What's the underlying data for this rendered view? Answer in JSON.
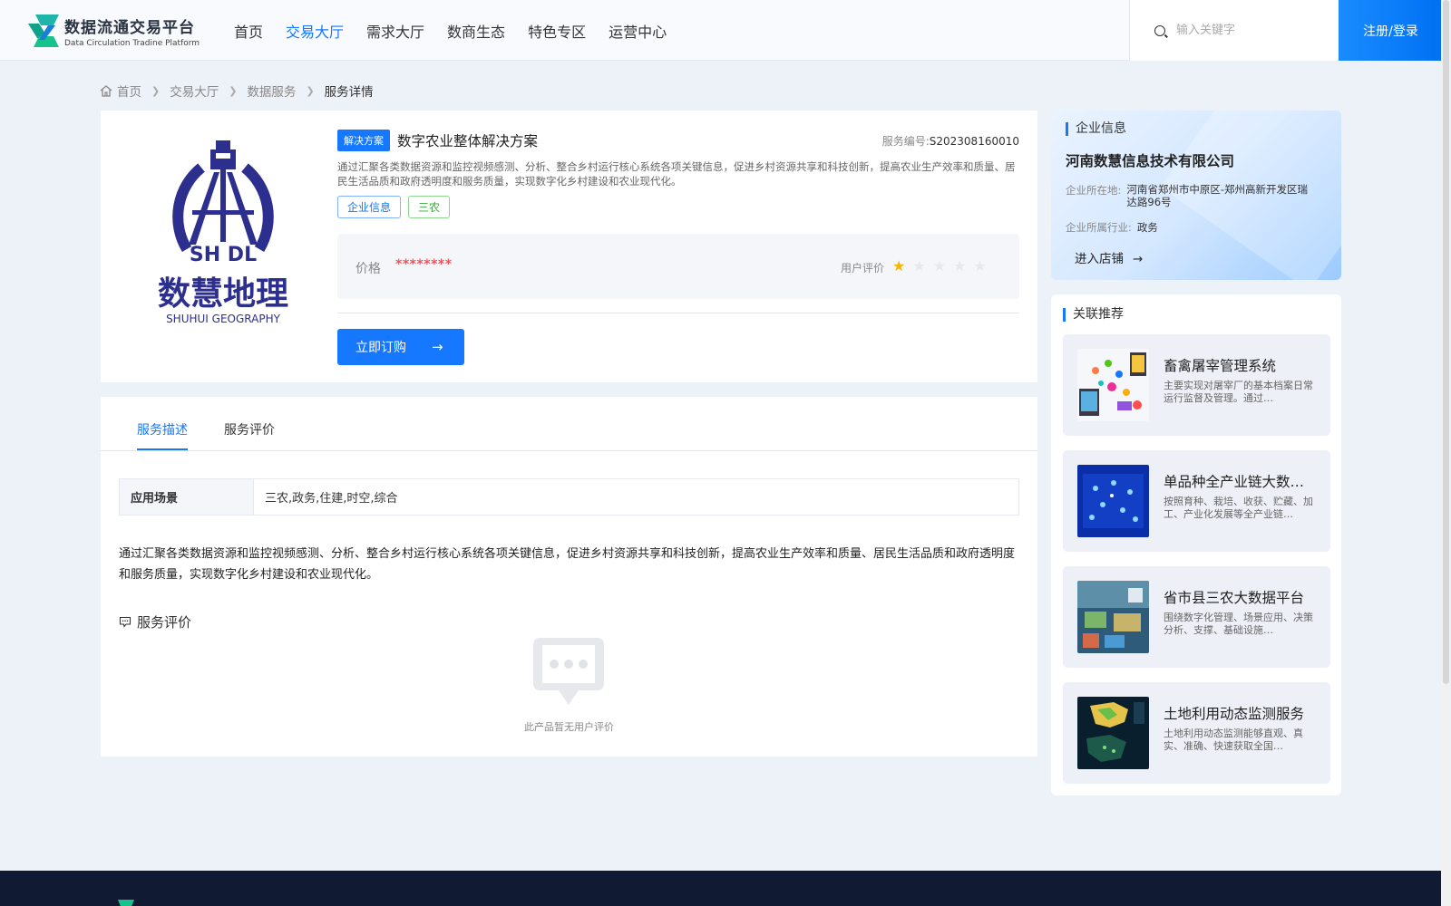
{
  "header": {
    "logo_cn": "数据流通交易平台",
    "logo_en": "Data Circulation Tradine Platform",
    "nav": [
      "首页",
      "交易大厅",
      "需求大厅",
      "数商生态",
      "特色专区",
      "运营中心"
    ],
    "active_nav": "交易大厅",
    "search_placeholder": "输入关键字",
    "login_label": "注册/登录"
  },
  "breadcrumb": [
    "首页",
    "交易大厅",
    "数据服务",
    "服务详情"
  ],
  "product": {
    "logo_cn": "数慧地理",
    "logo_en": "SHUHUI GEOGRAPHY",
    "logo_mark": "SH DL",
    "type_tag": "解决方案",
    "title": "数字农业整体解决方案",
    "code_label": "服务编号:",
    "code": "S202308160010",
    "description": "通过汇聚各类数据资源和监控视频感测、分析、整合乡村运行核心系统各项关键信息，促进乡村资源共享和科技创新，提高农业生产效率和质量、居民生活品质和政府透明度和服务质量，实现数字化乡村建设和农业现代化。",
    "tags": [
      "企业信息",
      "三农"
    ],
    "price_label": "价格",
    "price_value": "********",
    "rating_label": "用户评价",
    "rating": 1,
    "rating_max": 5,
    "order_button": "立即订购"
  },
  "detail": {
    "tabs": [
      "服务描述",
      "服务评价"
    ],
    "active_tab": "服务描述",
    "scene_label": "应用场景",
    "scene_value": "三农,政务,住建,时空,综合",
    "description": "通过汇聚各类数据资源和监控视频感测、分析、整合乡村运行核心系统各项关键信息，促进乡村资源共享和科技创新，提高农业生产效率和质量、居民生活品质和政府透明度和服务质量，实现数字化乡村建设和农业现代化。",
    "review_title": "服务评价",
    "empty_review_text": "此产品暂无用户评价"
  },
  "enterprise": {
    "section_title": "企业信息",
    "name": "河南数慧信息技术有限公司",
    "location_label": "企业所在地:",
    "location": "河南省郑州市中原区-郑州高新开发区瑞达路96号",
    "industry_label": "企业所属行业:",
    "industry": "政务",
    "shop_link": "进入店铺"
  },
  "recommendations": {
    "section_title": "关联推荐",
    "items": [
      {
        "name": "畜禽屠宰管理系统",
        "desc": "主要实现对屠宰厂的基本档案日常运行监督及管理。通过…"
      },
      {
        "name": "单品种全产业链大数…",
        "desc": "按照育种、栽培、收获、贮藏、加工、产业化发展等全产业链…"
      },
      {
        "name": "省市县三农大数据平台",
        "desc": "围绕数字化管理、场景应用、决策分析、支撑、基础设施…"
      },
      {
        "name": "土地利用动态监测服务",
        "desc": "土地利用动态监测能够直观、真实、准确、快速获取全国…"
      }
    ]
  },
  "colors": {
    "accent": "#1677ff",
    "logo_blue": "#2d2f8f",
    "price_red": "#ff4d4f",
    "star": "#f7b500",
    "footer": "#111a33"
  }
}
